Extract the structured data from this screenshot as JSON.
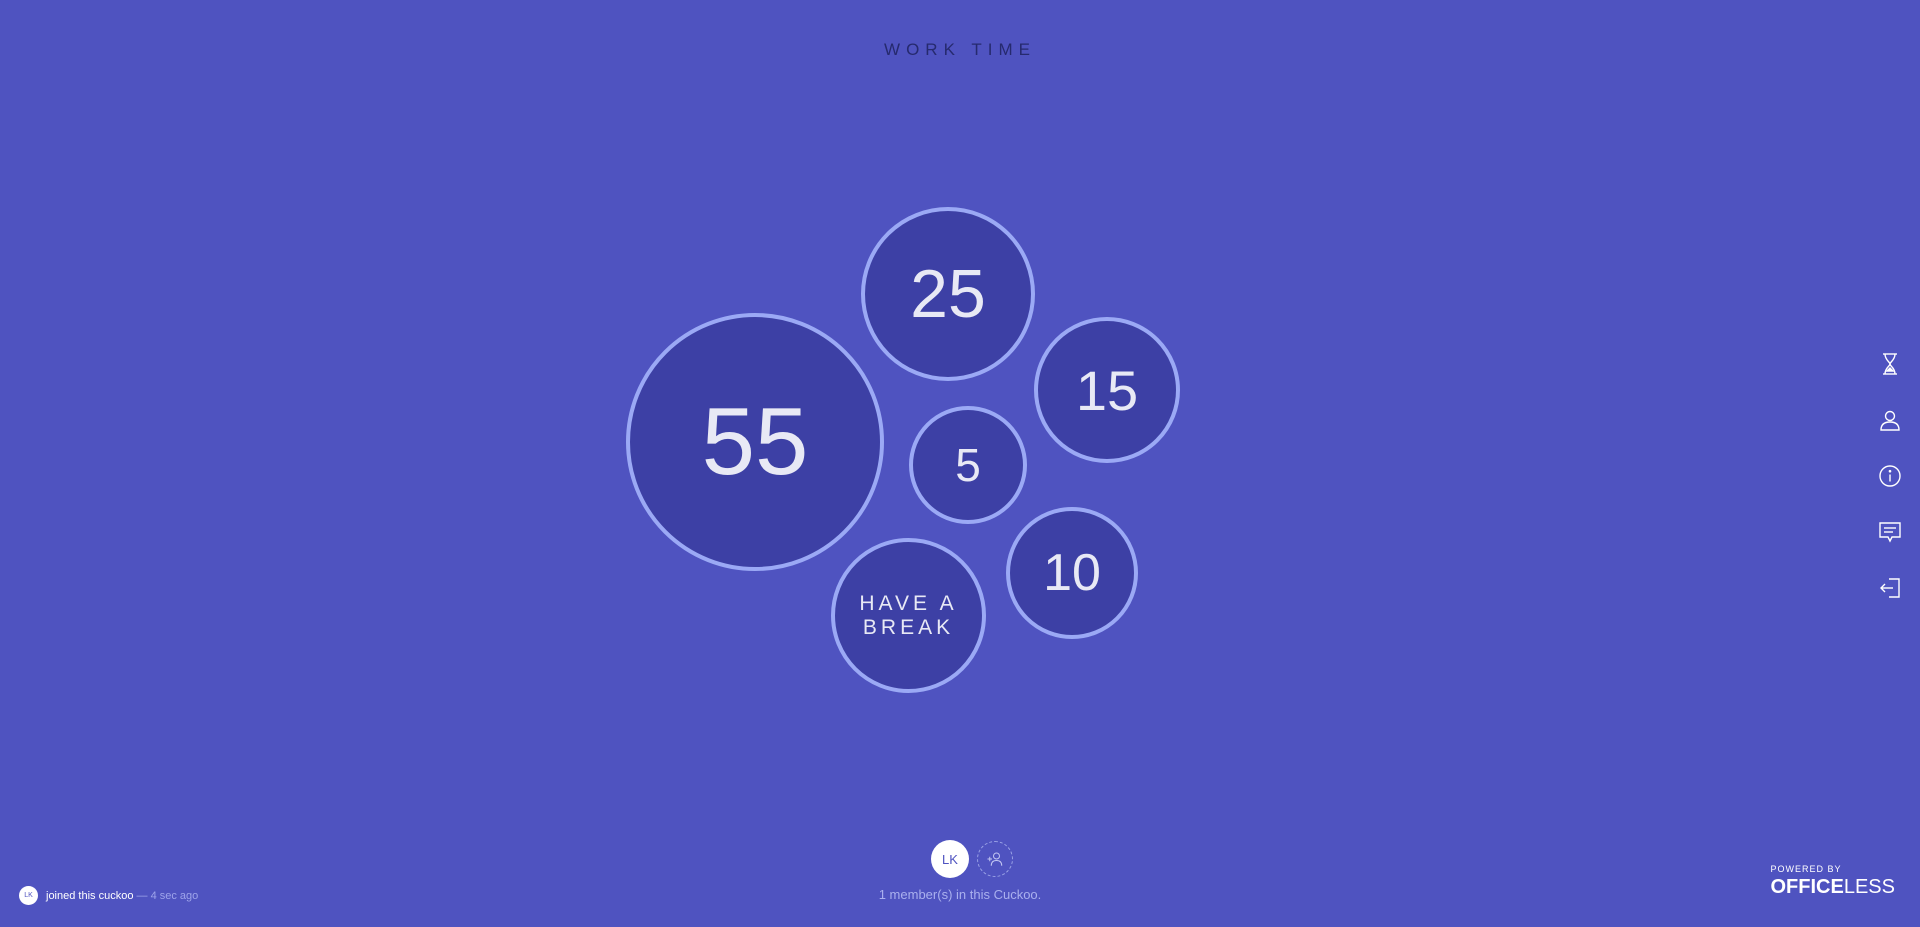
{
  "mode": {
    "title": "WORK TIME"
  },
  "bubbles": [
    {
      "label": "55"
    },
    {
      "label": "25"
    },
    {
      "label": "15"
    },
    {
      "label": "5"
    },
    {
      "label": "10"
    },
    {
      "label": "HAVE A BREAK"
    }
  ],
  "sidebar": {
    "icons": [
      "hourglass-icon",
      "user-icon",
      "info-icon",
      "chat-icon",
      "logout-icon"
    ]
  },
  "members": {
    "avatars": [
      {
        "initials": "LK"
      }
    ],
    "count_text": "1 member(s) in this Cuckoo."
  },
  "activity": {
    "initials": "LK",
    "text": "joined this cuckoo",
    "time": "— 4 sec ago"
  },
  "branding": {
    "powered_label": "POWERED BY",
    "brand_bold": "OFFICE",
    "brand_light": "LESS"
  },
  "colors": {
    "background": "#4f53c0",
    "bubble_fill": "#3d40a5",
    "bubble_border": "#9ba9f5",
    "title": "#262a6e"
  }
}
